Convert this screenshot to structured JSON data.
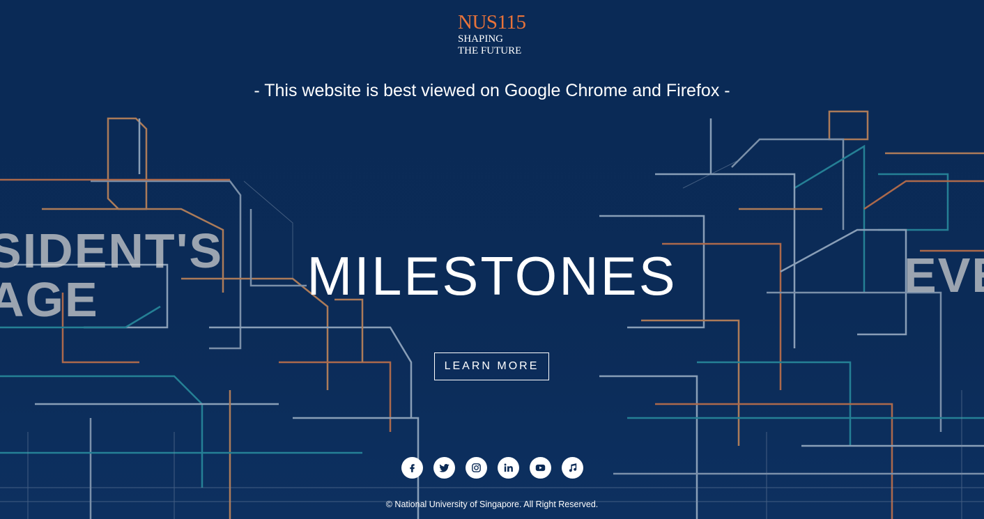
{
  "logo": {
    "main": "NUS115",
    "line1": "SHAPING",
    "line2": "THE FUTURE"
  },
  "notice": "- This website is best viewed on Google Chrome and Firefox -",
  "carousel": {
    "prev_title_line1": "SIDENT'S",
    "prev_title_line2": "AGE",
    "current_title": "MILESTONES",
    "next_title": "EVE",
    "cta_label": "LEARN MORE"
  },
  "socials": [
    {
      "name": "facebook-icon"
    },
    {
      "name": "twitter-icon"
    },
    {
      "name": "instagram-icon"
    },
    {
      "name": "linkedin-icon"
    },
    {
      "name": "youtube-icon"
    },
    {
      "name": "music-icon"
    }
  ],
  "footer": {
    "copyright": "© National University of Singapore. All Right Reserved."
  },
  "colors": {
    "background": "#0b2a55",
    "accent_orange": "#e8733a",
    "line_teal": "#2a8fa0",
    "line_grey": "#9aa7b8",
    "text": "#ffffff"
  }
}
